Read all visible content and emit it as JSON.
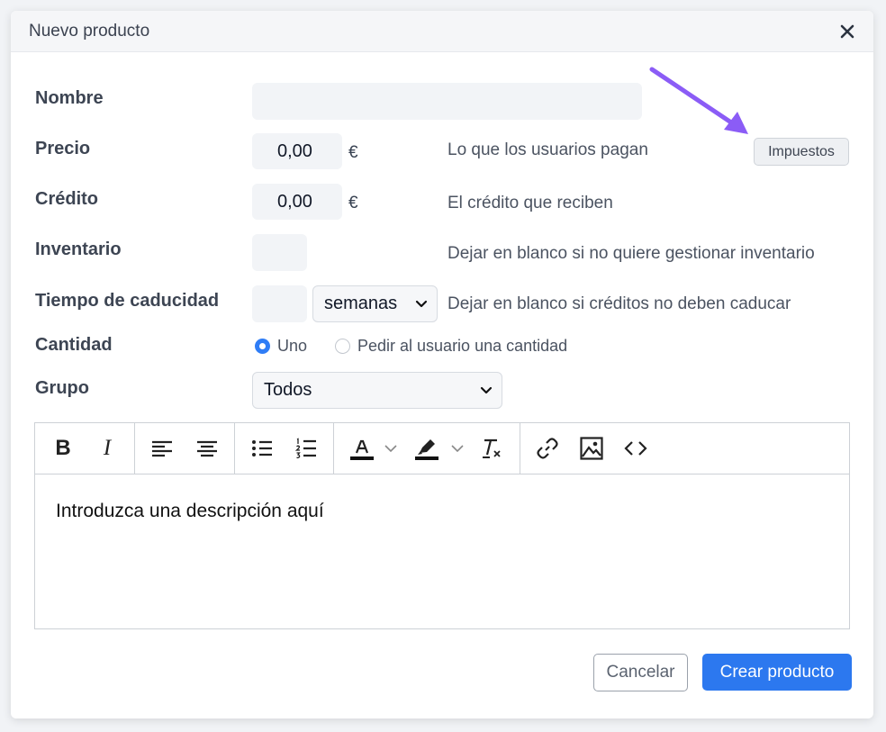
{
  "dialog": {
    "title": "Nuevo producto"
  },
  "form": {
    "name": {
      "label": "Nombre",
      "value": ""
    },
    "price": {
      "label": "Precio",
      "value": "0,00",
      "unit": "€",
      "hint": "Lo que los usuarios pagan",
      "tax_button": "Impuestos"
    },
    "credit": {
      "label": "Crédito",
      "value": "0,00",
      "unit": "€",
      "hint": "El crédito que reciben"
    },
    "inventory": {
      "label": "Inventario",
      "value": "",
      "hint": "Dejar en blanco si no quiere gestionar inventario"
    },
    "expiry": {
      "label": "Tiempo de caducidad",
      "value": "",
      "unit_selected": "semanas",
      "hint": "Dejar en blanco si créditos no deben caducar"
    },
    "quantity": {
      "label": "Cantidad",
      "options": [
        {
          "label": "Uno",
          "checked": true
        },
        {
          "label": "Pedir al usuario una cantidad",
          "checked": false
        }
      ]
    },
    "group": {
      "label": "Grupo",
      "selected": "Todos"
    }
  },
  "editor": {
    "toolbar": {
      "bold": "B",
      "italic": "I"
    },
    "content": "Introduzca una descripción aquí"
  },
  "actions": {
    "cancel": "Cancelar",
    "create": "Crear producto"
  },
  "colors": {
    "primary": "#2c78ef",
    "annotation_arrow": "#8b5cf6"
  }
}
